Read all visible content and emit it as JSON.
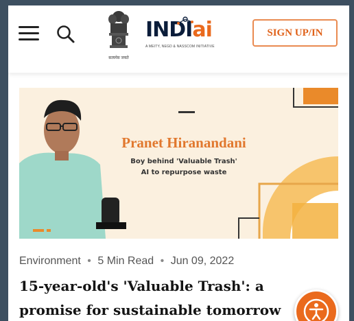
{
  "header": {
    "menu_icon": "hamburger-menu-icon",
    "search_icon": "search-icon",
    "emblem_caption": "सत्यमेव जयते",
    "logo": {
      "brand_main": "INDI",
      "brand_ai": "ai",
      "tagline": "A MEITY, NEGD & NASSCOM INITIATIVE"
    },
    "signup_label": "SIGN UP/IN"
  },
  "hero": {
    "name": "Pranet Hiranandani",
    "subtitle_line1": "Boy behind 'Valuable Trash'",
    "subtitle_line2": "AI to repurpose waste"
  },
  "article": {
    "category": "Environment",
    "read_time": "5 Min Read",
    "date": "Jun 09, 2022",
    "separator": "•",
    "title": "15-year-old's 'Valuable Trash': a promise for sustainable tomorrow"
  },
  "colors": {
    "accent": "#ea6a1d",
    "brand_dark": "#0b1d3a",
    "hero_bg": "#fbf0df"
  },
  "floating": {
    "accessibility_icon": "accessibility-icon"
  }
}
